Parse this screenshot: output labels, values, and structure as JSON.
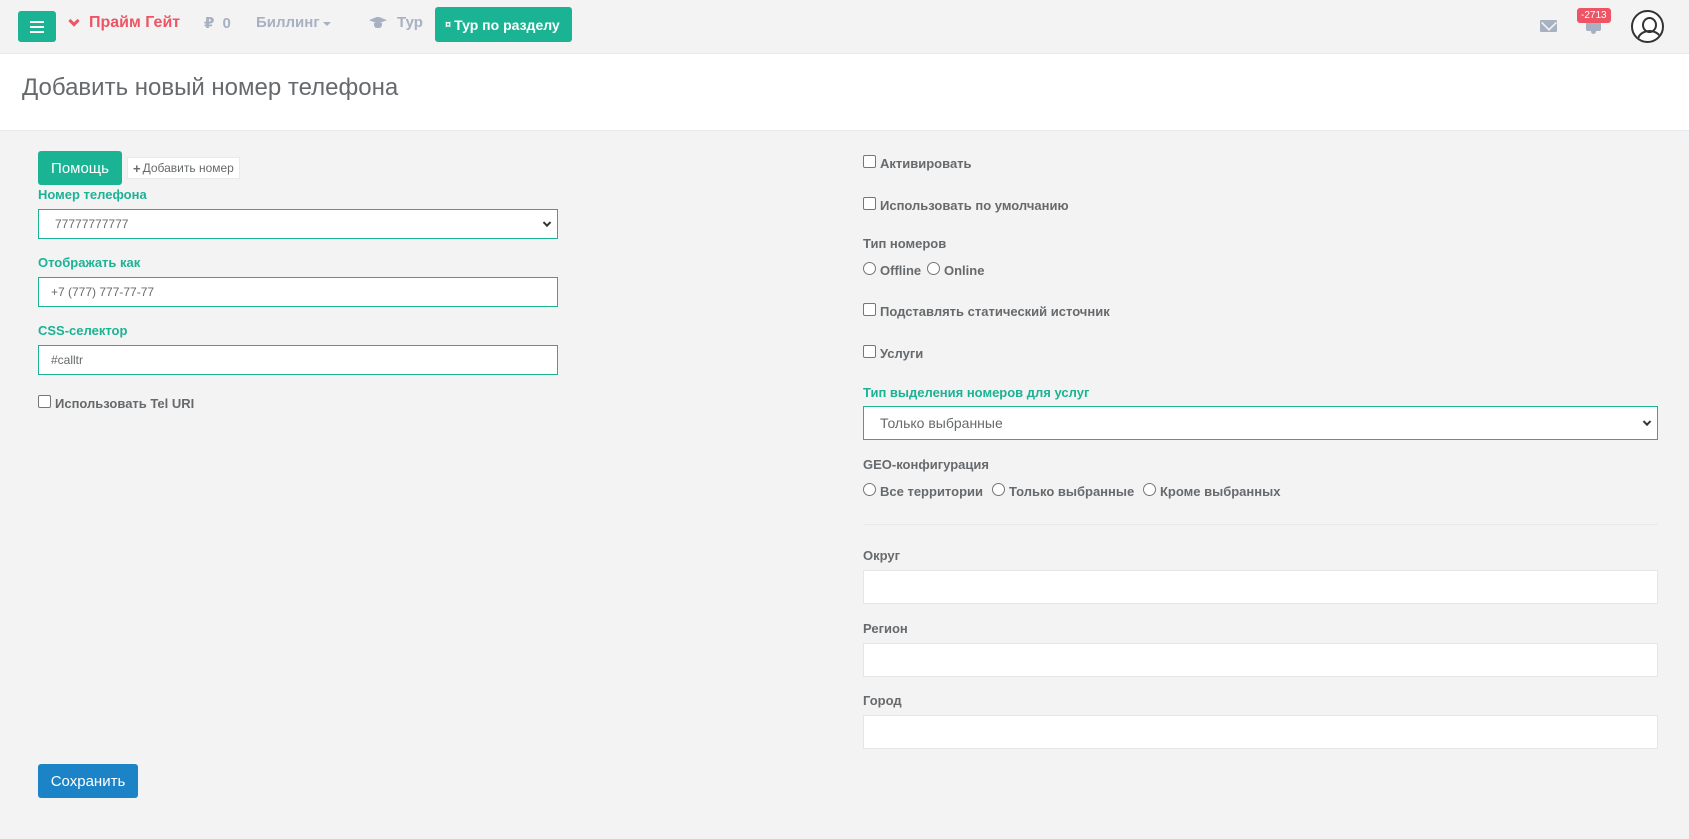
{
  "nav": {
    "brand": "Прайм Гейт",
    "currency_symbol": "₽",
    "balance": "0",
    "billing": "Биллинг",
    "tour": "Тур",
    "tour_section_button": "Тур по разделу",
    "notification_count": "-2713"
  },
  "page": {
    "title": "Добавить новый номер телефона"
  },
  "left": {
    "help_button": "Помощь",
    "add_number_button": "Добавить номер",
    "phone_label": "Номер телефона",
    "phone_value": "77777777777",
    "display_label": "Отображать как",
    "display_value": "+7 (777) 777-77-77",
    "css_label": "CSS-селектор",
    "css_value": "#calltr",
    "tel_uri": "Использовать Tel URI",
    "save_button": "Сохранить"
  },
  "right": {
    "activate": "Активировать",
    "use_default": "Использовать по умолчанию",
    "number_type_label": "Тип номеров",
    "offline": "Offline",
    "online": "Online",
    "static_source": "Подставлять статический источник",
    "services": "Услуги",
    "allocation_label": "Тип выделения номеров для услуг",
    "allocation_value": "Только выбранные",
    "geo_label": "GEO-конфигурация",
    "geo_all": "Все территории",
    "geo_only": "Только выбранные",
    "geo_except": "Кроме выбранных",
    "district_label": "Округ",
    "region_label": "Регион",
    "city_label": "Город"
  },
  "colors": {
    "accent": "#1ab394",
    "brand": "#ed5565",
    "save": "#1c84c6"
  }
}
